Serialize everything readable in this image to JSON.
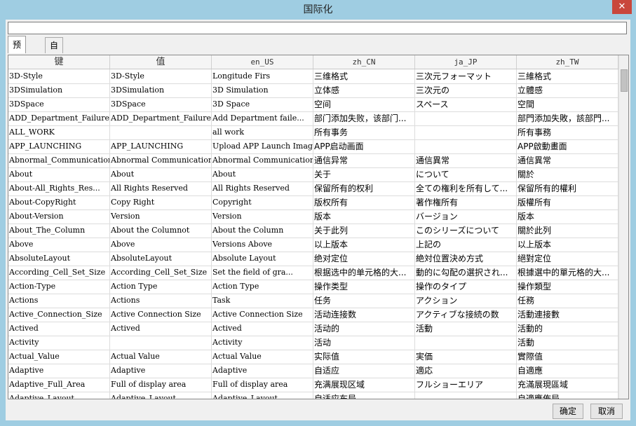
{
  "window": {
    "title": "国际化"
  },
  "search": {
    "value": ""
  },
  "tabs": [
    {
      "label": "预定义",
      "active": true
    },
    {
      "label": "自定义",
      "active": false
    }
  ],
  "table": {
    "columns": [
      "键",
      "值",
      "en_US",
      "zh_CN",
      "ja_JP",
      "zh_TW"
    ],
    "rows": [
      [
        "3D-Style",
        "3D-Style",
        "Longitude Firs",
        "三维格式",
        "三次元フォーマット",
        "三維格式"
      ],
      [
        "3DSimulation",
        "3DSimulation",
        "3D Simulation",
        "立体感",
        "三次元の",
        "立體感"
      ],
      [
        "3DSpace",
        "3DSpace",
        "3D Space",
        "空间",
        "スペース",
        "空間"
      ],
      [
        "ADD_Department_Failure",
        "ADD_Department_Failure",
        "Add Department faile...",
        "部门添加失败，该部门...",
        "",
        "部門添加失敗，該部門..."
      ],
      [
        "ALL_WORK",
        "",
        "all work",
        "所有事务",
        "",
        "所有事務"
      ],
      [
        "APP_LAUNCHING",
        "APP_LAUNCHING",
        "Upload APP Launch Image",
        "APP启动画面",
        "",
        "APP啟動畫面"
      ],
      [
        "Abnormal_Communication",
        "Abnormal Communication",
        "Abnormal Communication",
        "通信异常",
        "通信異常",
        "通信異常"
      ],
      [
        "About",
        "About",
        "About",
        "关于",
        "について",
        "關於"
      ],
      [
        "About-All_Rights_Res...",
        "All Rights Reserved",
        "All Rights Reserved",
        "保留所有的权利",
        "全ての権利を所有して...",
        "保留所有的權利"
      ],
      [
        "About-CopyRight",
        "Copy Right",
        "Copyright",
        "版权所有",
        "著作権所有",
        "版權所有"
      ],
      [
        "About-Version",
        "Version",
        "Version",
        "版本",
        "バージョン",
        "版本"
      ],
      [
        "About_The_Column",
        "About the Columnot",
        "About the Column",
        "关于此列",
        "このシリーズについて",
        "關於此列"
      ],
      [
        "Above",
        "Above",
        "Versions Above",
        "以上版本",
        "上記の",
        "以上版本"
      ],
      [
        "AbsoluteLayout",
        "AbsoluteLayout",
        "Absolute Layout",
        "绝对定位",
        "絶対位置決め方式",
        "絕對定位"
      ],
      [
        "According_Cell_Set_Size",
        "According_Cell_Set_Size",
        "Set the field of gra...",
        "根据选中的单元格的大...",
        "動的に勾配の選択され...",
        "根據選中的單元格的大..."
      ],
      [
        "Action-Type",
        "Action Type",
        "Action Type",
        "操作类型",
        "操作のタイプ",
        "操作類型"
      ],
      [
        "Actions",
        "Actions",
        "Task",
        "任务",
        "アクション",
        "任務"
      ],
      [
        "Active_Connection_Size",
        "Active Connection Size",
        "Active Connection Size",
        "活动连接数",
        "アクティブな接続の数",
        "活動連接數"
      ],
      [
        "Actived",
        "Actived",
        "Actived",
        "活动的",
        "活動",
        "活動的"
      ],
      [
        "Activity",
        "",
        "Activity",
        "活动",
        "",
        "活動"
      ],
      [
        "Actual_Value",
        "Actual Value",
        "Actual Value",
        "实际值",
        "実価",
        "實際值"
      ],
      [
        "Adaptive",
        "Adaptive",
        "Adaptive",
        "自适应",
        "適応",
        "自適應"
      ],
      [
        "Adaptive_Full_Area",
        "Full of display area",
        "Full of display area",
        "充满展现区域",
        "フルショーエリア",
        "充滿展現區域"
      ],
      [
        "Adaptive_Layout",
        "Adaptive_Layout",
        "Adaptive_Layout",
        "自适应布局",
        "",
        "自適應佈局"
      ]
    ]
  },
  "buttons": {
    "ok": "确定",
    "cancel": "取消"
  },
  "icons": {
    "close": "close-icon"
  }
}
